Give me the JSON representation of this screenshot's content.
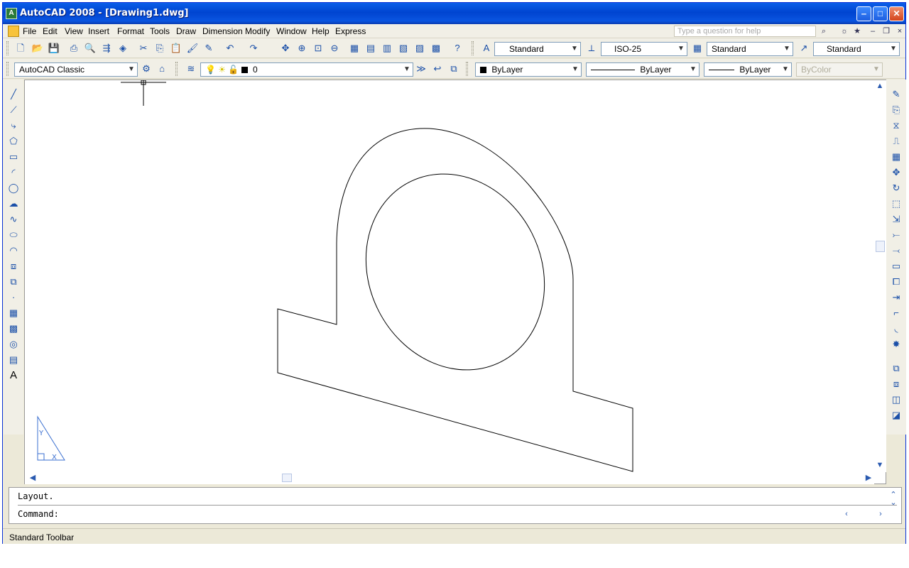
{
  "window": {
    "title": "AutoCAD 2008 - [Drawing1.dwg]"
  },
  "menu": {
    "items": [
      "File",
      "Edit",
      "View",
      "Insert",
      "Format",
      "Tools",
      "Draw",
      "Dimension",
      "Modify",
      "Window",
      "Help",
      "Express"
    ],
    "help_placeholder": "Type a question for help"
  },
  "toolbar": {
    "text_style": "Standard",
    "dim_style": "ISO-25",
    "table_style": "Standard",
    "multileader_style": "Standard",
    "workspace": "AutoCAD Classic",
    "layer": "0",
    "color": "ByLayer",
    "linetype": "ByLayer",
    "lineweight": "ByLayer",
    "plot_style": "ByColor"
  },
  "command": {
    "history": "Layout.",
    "prompt": "Command:"
  },
  "status": {
    "text": "Standard Toolbar"
  },
  "icons": {
    "left_draw": [
      "line-icon",
      "construction-line-icon",
      "polyline-icon",
      "polygon-icon",
      "rectangle-icon",
      "arc-icon",
      "circle-icon",
      "revision-cloud-icon",
      "spline-icon",
      "ellipse-icon",
      "ellipse-arc-icon",
      "insert-block-icon",
      "make-block-icon",
      "point-icon",
      "hatch-icon",
      "gradient-icon",
      "region-icon",
      "table-icon",
      "multiline-text-icon"
    ],
    "right_modify": [
      "erase-icon",
      "copy-icon",
      "mirror-icon",
      "offset-icon",
      "array-icon",
      "move-icon",
      "rotate-icon",
      "scale-icon",
      "stretch-icon",
      "trim-icon",
      "extend-icon",
      "break-at-point-icon",
      "break-icon",
      "join-icon",
      "chamfer-icon",
      "fillet-icon",
      "explode-icon",
      "draworder-front-icon",
      "draworder-back-icon",
      "draworder-above-icon",
      "draworder-under-icon"
    ]
  },
  "colors": {
    "title_bar": "#0a5ee8",
    "ucs_icon": "#3a6fd0"
  }
}
